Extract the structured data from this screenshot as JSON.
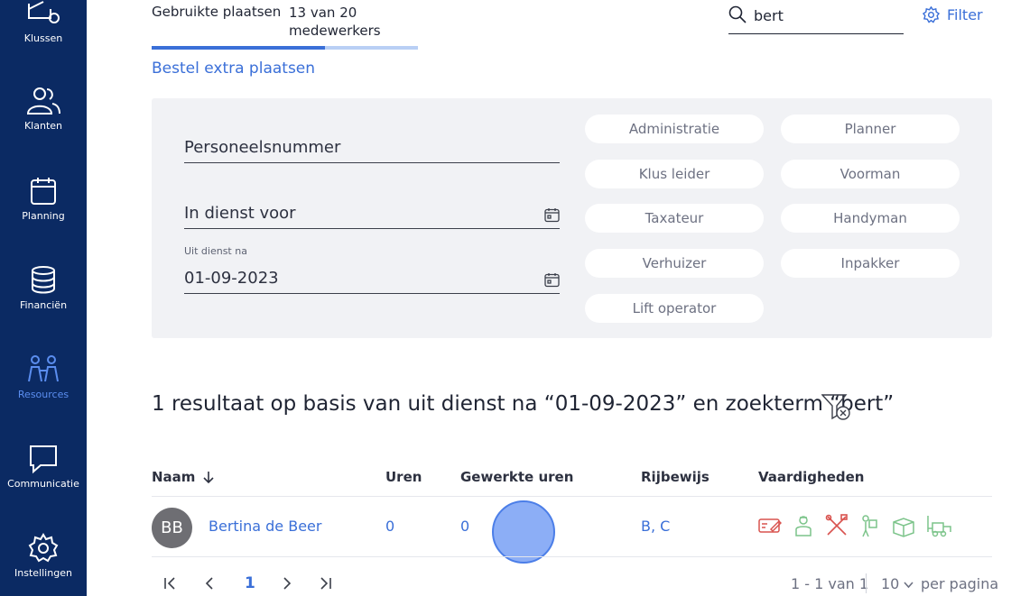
{
  "sidebar": {
    "items": [
      {
        "label": "Klussen",
        "icon": "truck-icon"
      },
      {
        "label": "Klanten",
        "icon": "customers-icon"
      },
      {
        "label": "Planning",
        "icon": "calendar-icon"
      },
      {
        "label": "Financiën",
        "icon": "coins-icon"
      },
      {
        "label": "Resources",
        "icon": "workers-icon",
        "active": true
      },
      {
        "label": "Communicatie",
        "icon": "chat-icon"
      },
      {
        "label": "Instellingen",
        "icon": "gear-icon"
      }
    ]
  },
  "header": {
    "seats_label": "Gebruikte plaatsen",
    "seats_count": "13 van 20 medewerkers",
    "seats_used": 13,
    "seats_total": 20,
    "order_link": "Bestel extra plaatsen",
    "search_value": "bert",
    "filter_label": "Filter"
  },
  "filters": {
    "personnel_number_placeholder": "Personeelsnummer",
    "employed_before_placeholder": "In dienst voor",
    "left_after_label": "Uit dienst na",
    "left_after_value": "01-09-2023",
    "chips": [
      "Administratie",
      "Planner",
      "Klus leider",
      "Voorman",
      "Taxateur",
      "Handyman",
      "Verhuizer",
      "Inpakker",
      "Lift operator"
    ]
  },
  "result_text": "1 resultaat op basis van uit dienst na “01-09-2023” en zoekterm “bert”",
  "table": {
    "columns": [
      "Naam",
      "Uren",
      "Gewerkte uren",
      "Rijbewijs",
      "Vaardigheden"
    ],
    "rows": [
      {
        "initials": "BB",
        "name": "Bertina de Beer",
        "hours": "0",
        "worked_hours": "0",
        "license": "B, C",
        "skills": [
          "admin-icon",
          "planner-icon",
          "handyman-icon",
          "mover-icon",
          "packer-icon",
          "lift-operator-icon"
        ]
      }
    ]
  },
  "pagination": {
    "current_page": "1",
    "range": "1 - 1 van 1",
    "per_page": "10",
    "per_page_label": "per pagina"
  },
  "colors": {
    "sidebar_bg": "#0b2a63",
    "accent": "#3a6fd8",
    "skill_red": "#d9534f",
    "skill_green": "#7cc48a"
  }
}
